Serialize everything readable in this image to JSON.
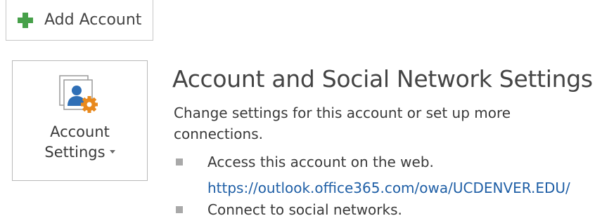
{
  "add_account": {
    "label": "Add Account",
    "icon": "plus-icon"
  },
  "account_settings_tile": {
    "label_line1": "Account",
    "label_line2": "Settings",
    "icon": "account-settings-icon"
  },
  "main": {
    "title": "Account and Social Network Settings",
    "description": "Change settings for this account or set up more connections.",
    "bullets": [
      {
        "text": "Access this account on the web.",
        "link": "https://outlook.office365.com/owa/UCDENVER.EDU/"
      },
      {
        "text": "Connect to social networks."
      }
    ]
  },
  "colors": {
    "plus_green": "#47a04a",
    "link_blue": "#1f5fa6",
    "gear_orange": "#e8891d",
    "person_blue": "#2f6fb6"
  }
}
